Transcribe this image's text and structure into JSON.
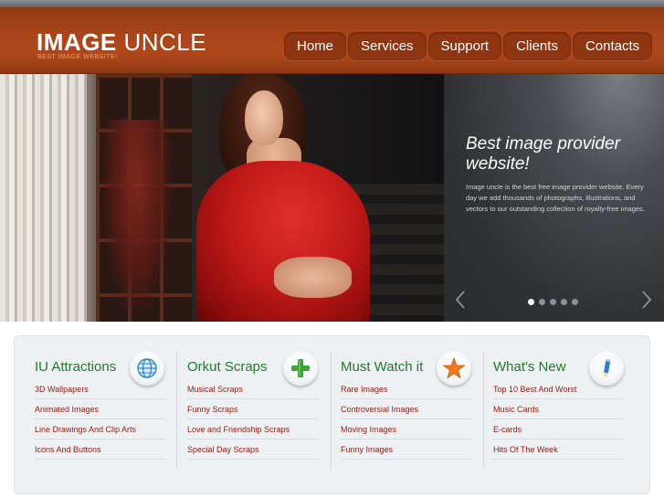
{
  "header": {
    "logo_bold": "IMAGE",
    "logo_light": "UNCLE",
    "tagline": "BEST IMAGE WEBSITE!",
    "nav": [
      "Home",
      "Services",
      "Support",
      "Clients",
      "Contacts"
    ]
  },
  "hero": {
    "title": "Best image provider website!",
    "description": "Image uncle is the best free image provider website. Every day we add thousands of photographs, illustrations, and vectors to our outstanding collection of royalty-free images.",
    "slide_count": 5,
    "active_slide": 1
  },
  "sections": [
    {
      "title": "IU Attractions",
      "icon": "globe-icon",
      "links": [
        "3D Wallpapers",
        "Animated Images",
        "Line Drawings And Clip Arts",
        "Icons And Buttons"
      ]
    },
    {
      "title": "Orkut Scraps",
      "icon": "plus-icon",
      "links": [
        "Musical Scraps",
        "Funny Scraps",
        "Love and Friendship Scraps",
        "Special Day Scraps"
      ]
    },
    {
      "title": "Must Watch it",
      "icon": "star-icon",
      "links": [
        "Rare Images",
        "Controversial Images",
        "Moving Images",
        "Funny Images"
      ]
    },
    {
      "title": "What's New",
      "icon": "pencil-icon",
      "links": [
        "Top 10 Best And Worst",
        "Music Cards",
        "E-cards",
        "Hits Of The Week"
      ]
    }
  ],
  "colors": {
    "header_bg": "#a7441a",
    "section_title": "#23782c",
    "link": "#8c1d10"
  }
}
